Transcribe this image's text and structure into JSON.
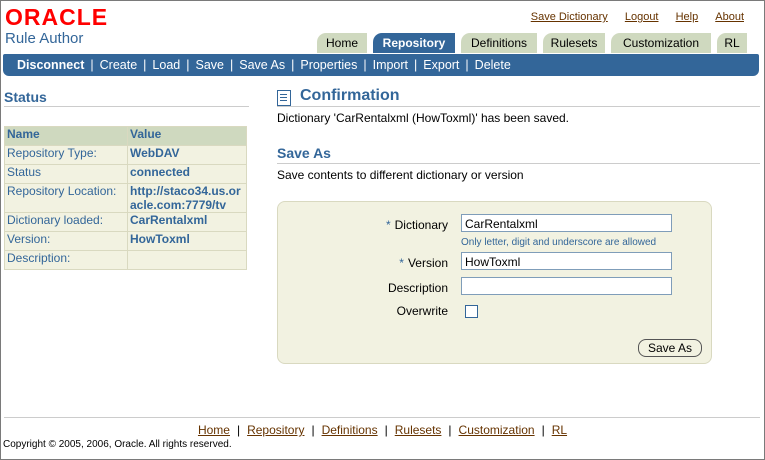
{
  "header": {
    "logo": "ORACLE",
    "product": "Rule Author",
    "global_links": [
      "Save Dictionary",
      "Logout",
      "Help",
      "About"
    ]
  },
  "tabs": [
    {
      "label": "Home",
      "active": false
    },
    {
      "label": "Repository",
      "active": true
    },
    {
      "label": "Definitions",
      "active": false
    },
    {
      "label": "Rulesets",
      "active": false
    },
    {
      "label": "Customization",
      "active": false
    },
    {
      "label": "RL",
      "active": false
    }
  ],
  "navbar": [
    "Disconnect",
    "Create",
    "Load",
    "Save",
    "Save As",
    "Properties",
    "Import",
    "Export",
    "Delete"
  ],
  "status": {
    "title": "Status",
    "col_name": "Name",
    "col_value": "Value",
    "rows": [
      {
        "name": "Repository Type:",
        "value": "WebDAV"
      },
      {
        "name": "Status",
        "value": "connected"
      },
      {
        "name": "Repository Location:",
        "value": "http://staco34.us.or acle.com:7779/tv"
      },
      {
        "name": "Dictionary loaded:",
        "value": "CarRentalxml"
      },
      {
        "name": "Version:",
        "value": "HowToxml"
      },
      {
        "name": "Description:",
        "value": ""
      }
    ]
  },
  "confirmation": {
    "title": "Confirmation",
    "message": "Dictionary 'CarRentalxml (HowToxml)' has been saved."
  },
  "save_as": {
    "title": "Save As",
    "description": "Save contents to different dictionary or version",
    "required_mark": "*",
    "dictionary_label": "Dictionary",
    "dictionary_value": "CarRentalxml",
    "dictionary_hint": "Only letter, digit and underscore are allowed",
    "version_label": "Version",
    "version_value": "HowToxml",
    "description_label": "Description",
    "description_value": "",
    "overwrite_label": "Overwrite",
    "button": "Save As"
  },
  "footer": {
    "links": [
      "Home",
      "Repository",
      "Definitions",
      "Rulesets",
      "Customization",
      "RL"
    ],
    "copyright": "Copyright © 2005, 2006, Oracle. All rights reserved."
  },
  "colors": {
    "brand": "#ff0000",
    "accent": "#336699",
    "tab_inactive": "#cfd9bf",
    "panel": "#f2f2e1"
  }
}
